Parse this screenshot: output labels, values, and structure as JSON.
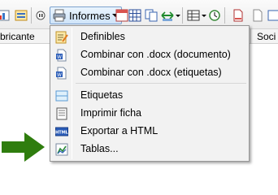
{
  "toolbar": {
    "informes_label": "Informes",
    "icons": [
      "chart-icon",
      "form-icon",
      "unknown-icon",
      "print-icon",
      "grid-icon",
      "copy-icon",
      "fit-width-icon",
      "columns-icon",
      "refresh-clock-icon",
      "document-icon"
    ]
  },
  "header": {
    "col1": "bricante",
    "col2": "Soci"
  },
  "menu": {
    "items": [
      {
        "label": "Definibles",
        "icon": "definibles-icon"
      },
      {
        "label": "Combinar con .docx (documento)",
        "icon": "word-doc-icon"
      },
      {
        "label": "Combinar con .docx (etiquetas)",
        "icon": "word-labels-icon"
      },
      {
        "label": "Etiquetas",
        "icon": "labels-icon"
      },
      {
        "label": "Imprimir ficha",
        "icon": "print-card-icon"
      },
      {
        "label": "Exportar a HTML",
        "icon": "html-export-icon"
      },
      {
        "label": "Tablas...",
        "icon": "tables-chart-icon"
      }
    ]
  },
  "colors": {
    "arrow": "#2f7d0e",
    "menu_bg": "#f2f2f2",
    "button_highlight": "#cfe4f9"
  }
}
